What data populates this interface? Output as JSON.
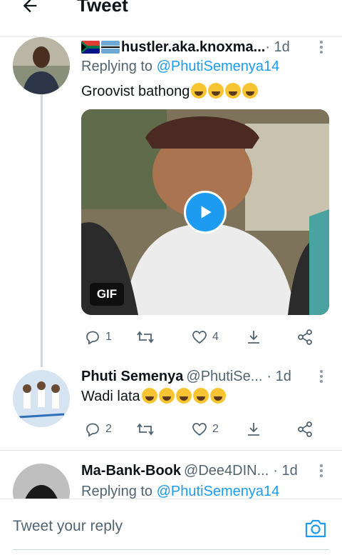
{
  "header": {
    "title": "Tweet",
    "back_icon": "arrow-left-icon"
  },
  "tweets": [
    {
      "display_name": "hustler.aka.knoxma...",
      "handle": "",
      "time": " · 1d",
      "replying_prefix": "Replying to ",
      "replying_to": "@PhutiSemenya14",
      "text": "Groovist bathong",
      "emojis": [
        "rofl",
        "joy",
        "rofl",
        "joy"
      ],
      "flags": [
        "south-africa-flag",
        "botswana-flag"
      ],
      "media": {
        "type": "gif",
        "badge": "GIF"
      },
      "stats": {
        "replies": "1",
        "retweets": "",
        "likes": "4"
      }
    },
    {
      "display_name": "Phuti Semenya",
      "handle": "@PhutiSe...",
      "time": " · 1d",
      "text": "Wadi lata",
      "emojis": [
        "crying",
        "joy",
        "joy",
        "joy",
        "joy"
      ],
      "stats": {
        "replies": "2",
        "retweets": "",
        "likes": "2"
      }
    },
    {
      "display_name": "Ma-Bank-Book",
      "handle": "@Dee4DIN...",
      "time": " · 1d",
      "replying_prefix": "Replying to ",
      "replying_to": "@PhutiSemenya14"
    }
  ],
  "reply_bar": {
    "placeholder": "Tweet your reply",
    "camera_icon": "camera-icon"
  },
  "colors": {
    "accent": "#1d9bf0",
    "text_primary": "#0f1419",
    "text_secondary": "#536471",
    "divider": "#e6e9ec"
  }
}
